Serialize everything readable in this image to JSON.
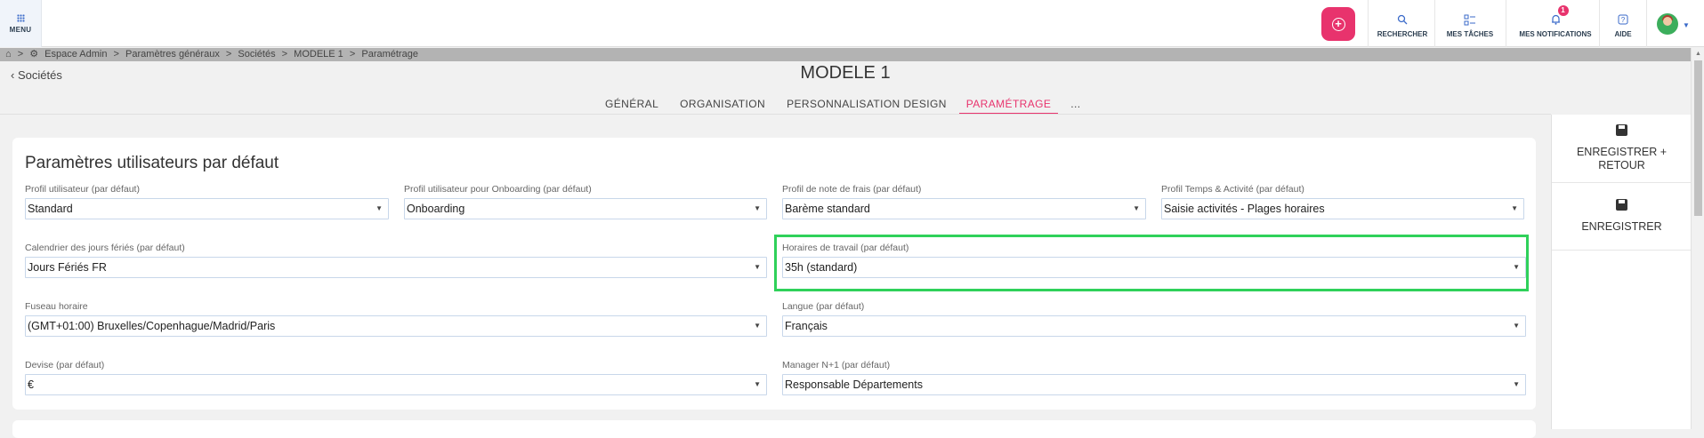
{
  "topbar": {
    "menu_label": "MENU",
    "search_label": "RECHERCHER",
    "tasks_label": "MES TÂCHES",
    "notifications_label": "MES NOTIFICATIONS",
    "notifications_count": "1",
    "help_label": "AIDE",
    "accent_color": "#e8336d"
  },
  "breadcrumb": {
    "items": [
      "Espace Admin",
      "Paramètres généraux",
      "Sociétés",
      "MODELE 1",
      "Paramétrage"
    ],
    "separator": ">"
  },
  "header": {
    "back_label": "Sociétés",
    "title": "MODELE 1",
    "tabs": [
      "GÉNÉRAL",
      "ORGANISATION",
      "PERSONNALISATION DESIGN",
      "PARAMÉTRAGE",
      "..."
    ],
    "active_tab": "PARAMÉTRAGE"
  },
  "section": {
    "title": "Paramètres utilisateurs par défaut",
    "fields": [
      {
        "label": "Profil utilisateur (par défaut)",
        "value": "Standard"
      },
      {
        "label": "Profil utilisateur pour Onboarding (par défaut)",
        "value": "Onboarding"
      },
      {
        "label": "Profil de note de frais (par défaut)",
        "value": "Barème standard"
      },
      {
        "label": "Profil Temps & Activité (par défaut)",
        "value": "Saisie activités - Plages horaires"
      },
      {
        "label": "Calendrier des jours fériés (par défaut)",
        "value": "Jours Fériés FR"
      },
      {
        "label": "Horaires de travail (par défaut)",
        "value": "35h (standard)"
      },
      {
        "label": "Fuseau horaire",
        "value": "(GMT+01:00) Bruxelles/Copenhague/Madrid/Paris"
      },
      {
        "label": "Langue (par défaut)",
        "value": "Français"
      },
      {
        "label": "Devise (par défaut)",
        "value": "€"
      },
      {
        "label": "Manager N+1 (par défaut)",
        "value": "Responsable Départements"
      }
    ]
  },
  "side_panel": {
    "save_return_label": "ENREGISTRER + RETOUR",
    "save_label": "ENREGISTRER"
  },
  "highlight_color": "#2fd15a"
}
